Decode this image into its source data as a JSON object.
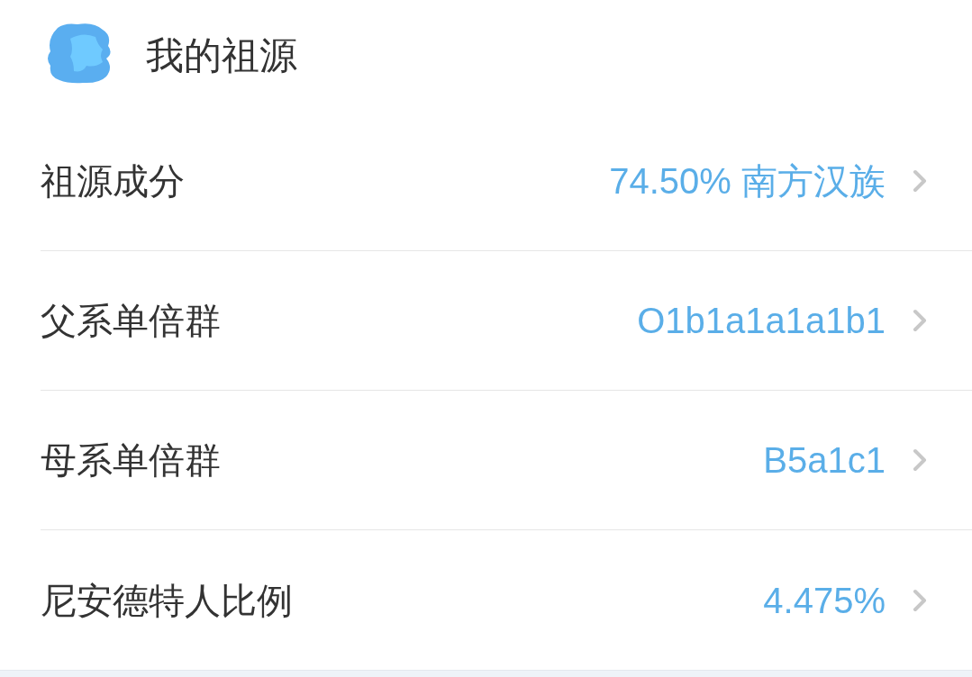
{
  "header": {
    "title": "我的祖源"
  },
  "rows": [
    {
      "label": "祖源成分",
      "value": "74.50% 南方汉族"
    },
    {
      "label": "父系单倍群",
      "value": "O1b1a1a1a1b1"
    },
    {
      "label": "母系单倍群",
      "value": "B5a1c1"
    },
    {
      "label": "尼安德特人比例",
      "value": "4.475%"
    }
  ]
}
